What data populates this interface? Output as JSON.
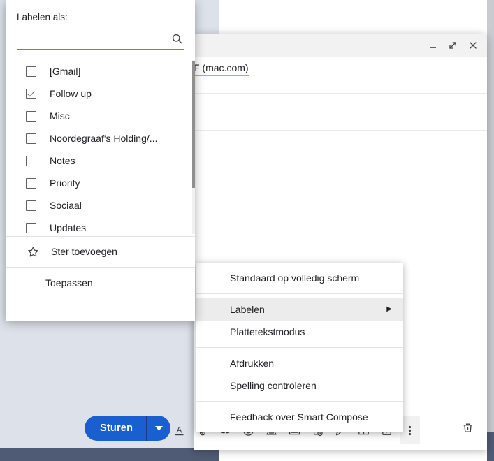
{
  "compose_window": {
    "recipient_chip": "F (mac.com)",
    "window_controls": {
      "minimize": "minimize-icon",
      "expand": "expand-icon",
      "close": "close-icon"
    },
    "toolbar": {
      "send_label": "Sturen",
      "send_caret": "caret-down-icon",
      "icons": [
        {
          "name": "formatting-options-icon",
          "glyph": "A"
        },
        {
          "name": "attach-file-icon",
          "glyph": "paperclip"
        },
        {
          "name": "insert-link-icon",
          "glyph": "link"
        },
        {
          "name": "insert-emoji-icon",
          "glyph": "emoji"
        },
        {
          "name": "insert-drive-file-icon",
          "glyph": "drive"
        },
        {
          "name": "insert-photo-icon",
          "glyph": "photo"
        },
        {
          "name": "confidential-mode-icon",
          "glyph": "lock-clock"
        },
        {
          "name": "insert-signature-icon",
          "glyph": "pen"
        },
        {
          "name": "insert-template-icon",
          "glyph": "layout"
        },
        {
          "name": "schedule-send-icon",
          "glyph": "calendar"
        },
        {
          "name": "more-options-icon",
          "glyph": "dots-vertical"
        }
      ],
      "discard_draft": "trash-icon"
    }
  },
  "context_menu": {
    "groups": [
      [
        {
          "label": "Standaard op volledig scherm",
          "highlighted": false,
          "submenu": false
        }
      ],
      [
        {
          "label": "Labelen",
          "highlighted": true,
          "submenu": true
        },
        {
          "label": "Plattetekstmodus",
          "highlighted": false,
          "submenu": false
        }
      ],
      [
        {
          "label": "Afdrukken",
          "highlighted": false,
          "submenu": false
        },
        {
          "label": "Spelling controleren",
          "highlighted": false,
          "submenu": false
        }
      ],
      [
        {
          "label": "Feedback over Smart Compose",
          "highlighted": false,
          "submenu": false
        }
      ]
    ],
    "submenu_arrow": "▶"
  },
  "labels_dropdown": {
    "title": "Labelen als:",
    "search": {
      "value": "",
      "placeholder": "",
      "icon": "search-icon"
    },
    "labels": [
      {
        "name": "[Gmail]",
        "checked": false
      },
      {
        "name": "Follow up",
        "checked": true
      },
      {
        "name": "Misc",
        "checked": false
      },
      {
        "name": "Noordegraaf's Holding/...",
        "checked": false
      },
      {
        "name": "Notes",
        "checked": false
      },
      {
        "name": "Priority",
        "checked": false
      },
      {
        "name": "Sociaal",
        "checked": false
      },
      {
        "name": "Updates",
        "checked": false
      }
    ],
    "star_action": {
      "label": "Ster toevoegen",
      "icon": "star-outline-icon"
    },
    "apply_action": {
      "label": "Toepassen"
    }
  },
  "colors": {
    "accent_blue": "#1a5fd0",
    "search_underline": "#4285f4",
    "chip_underline": "#e8a33d",
    "menu_highlight": "#ececec",
    "desktop_panel": "#dde1e9",
    "taskbar": "#4f5b74"
  }
}
